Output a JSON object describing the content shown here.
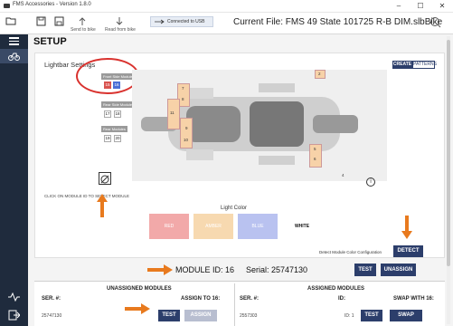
{
  "window": {
    "title": "FMS Accessories - Version 1.8.0",
    "minimize": "–",
    "maximize": "☐",
    "close": "✕"
  },
  "toolbar": {
    "send_to_bike": "Send to bike",
    "read_from_bike": "Read from bike",
    "connection": "Connected to USB",
    "current_file": "Current File: FMS 49 State 101725 R-B DIM.slbBike"
  },
  "page": {
    "title": "SETUP"
  },
  "lightbar": {
    "section_title": "Lightbar Settings",
    "create_label": "CREATE",
    "patterns_label": "PATTERNS",
    "front_group": "Front Side Modules",
    "front_modules": [
      "15",
      "16"
    ],
    "rear_group": "Rear Side Modules",
    "rear_modules": [
      "17",
      "18"
    ],
    "rear2_group": "Rear Modules",
    "rear2_modules": [
      "19",
      "20"
    ],
    "led_numbers": [
      "1",
      "2",
      "3",
      "4",
      "5",
      "6",
      "7",
      "8",
      "9",
      "10",
      "11",
      "12",
      "13",
      "14"
    ],
    "click_note": "CLICK ON MODULE ID TO SELECT MODULE",
    "info_symbol": "i"
  },
  "light_color": {
    "label": "Light Color",
    "options": [
      {
        "label": "RED",
        "color": "#f2a9a9"
      },
      {
        "label": "AMBER",
        "color": "#f7d9b0"
      },
      {
        "label": "BLUE",
        "color": "#b9c2f0"
      },
      {
        "label": "WHITE",
        "color": "#ffffff"
      }
    ]
  },
  "detect": {
    "label": "Detect Module Color Configuration",
    "button": "DETECT"
  },
  "module_info": {
    "module_id": "MODULE ID: 16",
    "serial": "Serial: 25747130",
    "test": "TEST",
    "unassign": "UNASSIGN"
  },
  "unassigned_modules": {
    "title": "UNASSIGNED MODULES",
    "ser_header": "SER. #:",
    "assign_header": "ASSIGN TO 16:",
    "row_serial": "25747130",
    "test": "TEST",
    "assign": "ASSIGN"
  },
  "assigned_modules": {
    "title": "ASSIGNED MODULES",
    "ser_header": "SER. #:",
    "id_header": "ID:",
    "swap_header": "SWAP WITH 16:",
    "row_serial": "2557303",
    "row_id": "ID: 1",
    "test": "TEST",
    "swap": "SWAP"
  },
  "colors": {
    "sidebar": "#1f2b3d",
    "accent": "#2c3e6b",
    "annotation_arrow": "#e87a1e",
    "annotation_circle": "#d9322e"
  }
}
